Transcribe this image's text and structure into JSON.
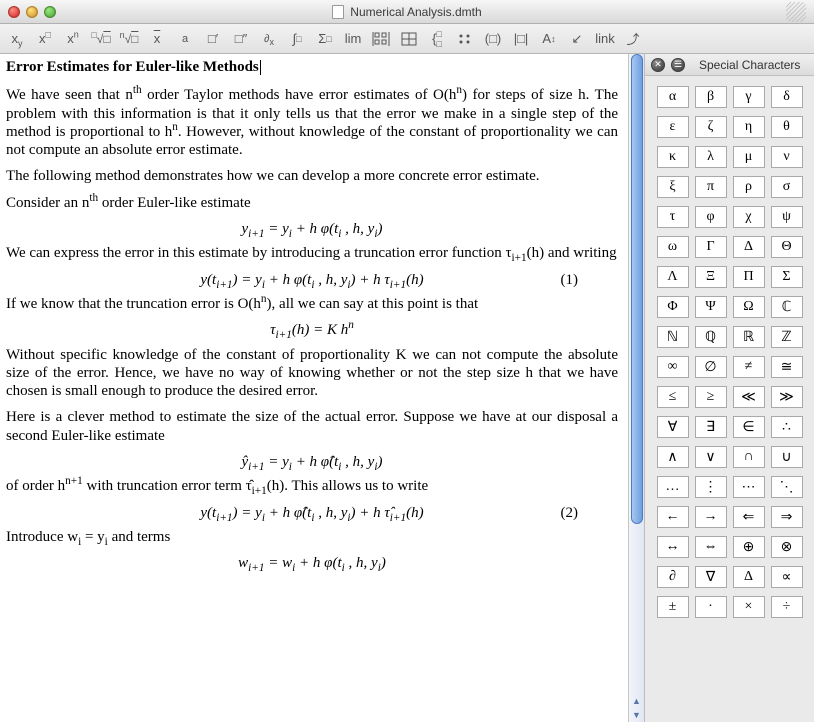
{
  "window": {
    "title": "Numerical Analysis.dmth"
  },
  "toolbar": {
    "items": [
      {
        "name": "fraction-a-b",
        "label": "x⁄y"
      },
      {
        "name": "power",
        "label": "x"
      },
      {
        "name": "power-n",
        "label": "x"
      },
      {
        "name": "sqrt",
        "label": "√"
      },
      {
        "name": "root-n",
        "label": "ⁿ√"
      },
      {
        "name": "x-bar",
        "label": "x̄"
      },
      {
        "name": "fraction",
        "label": "a⁄b"
      },
      {
        "name": "diff-prime",
        "label": "d′"
      },
      {
        "name": "diff-dprime",
        "label": "d″"
      },
      {
        "name": "partial",
        "label": "∂⁄∂"
      },
      {
        "name": "integral",
        "label": "∫"
      },
      {
        "name": "sum",
        "label": "Σ"
      },
      {
        "name": "limit",
        "label": "lim"
      },
      {
        "name": "matrix",
        "label": "[::]"
      },
      {
        "name": "grid",
        "label": "⊞"
      },
      {
        "name": "cases",
        "label": "{|"
      },
      {
        "name": "cases2",
        "label": "{::}"
      },
      {
        "name": "paren",
        "label": "(□)"
      },
      {
        "name": "abs",
        "label": "|□|"
      },
      {
        "name": "sym1",
        "label": "A↕"
      },
      {
        "name": "sym2",
        "label": "↙"
      },
      {
        "name": "link",
        "label": "link"
      },
      {
        "name": "sym3",
        "label": "⤴"
      }
    ]
  },
  "doc": {
    "title": "Error Estimates for Euler-like Methods",
    "p1": "We have seen that n<sup>th</sup> order Taylor methods have error estimates of O(h<sup>n</sup>) for steps of size h. The problem with this information is that it only tells us that the error we make in a single step of the method is proportional to h<sup>n</sup>. However, without knowledge of the constant of proportionality we can not compute an absolute error estimate.",
    "p2": "The following method demonstrates how we can develop a more concrete error estimate.",
    "p3": "Consider an n<sup>th</sup> order Euler-like estimate",
    "eq1": "y<sub>i+1</sub> = y<sub>i</sub> + h φ(t<sub>i</sub> , h, y<sub>i</sub>)",
    "p4": "We can express the error in this estimate by introducing a truncation error function τ<sub>i+1</sub>(h) and writing",
    "eq2": "y(t<sub>i+1</sub>) = y<sub>i</sub> + h φ(t<sub>i</sub> , h, y<sub>i</sub>) + h τ<sub>i+1</sub>(h)",
    "eqnum2": "(1)",
    "p5": "If we know that the truncation error is O(h<sup>n</sup>), all we can say at this point is that",
    "eq3": "τ<sub>i+1</sub>(h) = K h<sup>n</sup>",
    "p6": "Without specific knowledge of the constant of proportionality K we can not compute the absolute size of the error. Hence, we have no way of knowing whether or not the step size h that we have chosen is small enough to produce the desired error.",
    "p7": "Here is a clever method to estimate the size of the actual error. Suppose we have at our disposal a second Euler-like estimate",
    "eq4": "ŷ<sub>i+1</sub> = y<sub>i</sub> + h φ̂(t<sub>i</sub> , h, y<sub>i</sub>)",
    "p8": "of order h<sup>n+1</sup> with truncation error term τ̂<sub>i+1</sub>(h). This allows us to write",
    "eq5": "y(t<sub>i+1</sub>) = y<sub>i</sub> + h φ̂(t<sub>i</sub> , h, y<sub>i</sub>) + h τ̂<sub>i+1</sub>(h)",
    "eqnum5": "(2)",
    "p9": "Introduce w<sub>i</sub> = y<sub>i</sub> and terms",
    "eq6": "w<sub>i+1</sub> = w<sub>i</sub> + h φ(t<sub>i</sub> , h, y<sub>i</sub>)"
  },
  "panel": {
    "title": "Special Characters",
    "rows": [
      [
        "α",
        "β",
        "γ",
        "δ"
      ],
      [
        "ε",
        "ζ",
        "η",
        "θ"
      ],
      [
        "κ",
        "λ",
        "μ",
        "ν"
      ],
      [
        "ξ",
        "π",
        "ρ",
        "σ"
      ],
      [
        "τ",
        "φ",
        "χ",
        "ψ"
      ],
      [
        "ω",
        "Γ",
        "Δ",
        "Θ"
      ],
      [
        "Λ",
        "Ξ",
        "Π",
        "Σ"
      ],
      [
        "Φ",
        "Ψ",
        "Ω",
        "ℂ"
      ],
      [
        "ℕ",
        "ℚ",
        "ℝ",
        "ℤ"
      ],
      [
        "∞",
        "∅",
        "≠",
        "≅"
      ],
      [
        "≤",
        "≥",
        "≪",
        "≫"
      ],
      [
        "∀",
        "∃",
        "∈",
        "∴"
      ],
      [
        "∧",
        "∨",
        "∩",
        "∪"
      ],
      [
        "…",
        "⋮",
        "⋯",
        "⋱"
      ],
      [
        "←",
        "→",
        "⇐",
        "⇒"
      ],
      [
        "↔",
        "⇔",
        "⊕",
        "⊗"
      ],
      [
        "∂",
        "∇",
        "Δ",
        "∝"
      ],
      [
        "±",
        "·",
        "×",
        "÷"
      ]
    ]
  }
}
